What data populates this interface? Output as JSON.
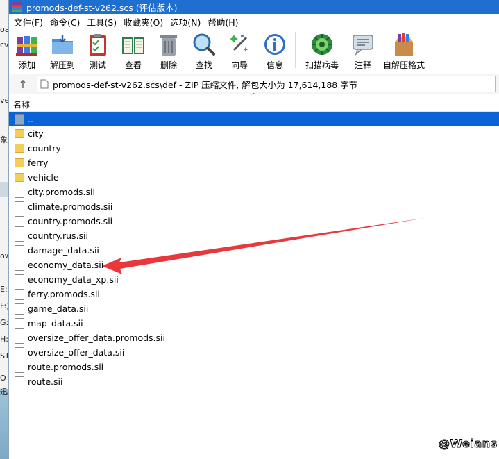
{
  "window": {
    "title": "promods-def-st-v262.scs (评估版本)"
  },
  "menu": [
    "文件(F)",
    "命令(C)",
    "工具(S)",
    "收藏夹(O)",
    "选项(N)",
    "帮助(H)"
  ],
  "toolbar": [
    {
      "id": "add",
      "label": "添加",
      "icon": "books-icon"
    },
    {
      "id": "extract",
      "label": "解压到",
      "icon": "folder-extract-icon"
    },
    {
      "id": "test",
      "label": "测试",
      "icon": "clipboard-check-icon"
    },
    {
      "id": "view",
      "label": "查看",
      "icon": "open-book-icon"
    },
    {
      "id": "delete",
      "label": "删除",
      "icon": "trash-icon"
    },
    {
      "id": "find",
      "label": "查找",
      "icon": "magnifier-icon"
    },
    {
      "id": "wizard",
      "label": "向导",
      "icon": "magic-wand-icon"
    },
    {
      "id": "info",
      "label": "信息",
      "icon": "info-icon"
    },
    {
      "id": "scan",
      "label": "扫描病毒",
      "icon": "virus-scan-icon"
    },
    {
      "id": "comment",
      "label": "注释",
      "icon": "comment-icon"
    },
    {
      "id": "sfx",
      "label": "自解压格式",
      "icon": "sfx-box-icon"
    }
  ],
  "address": {
    "path": "promods-def-st-v262.scs\\def - ZIP 压缩文件, 解包大小为 17,614,188 字节"
  },
  "list": {
    "column_name": "名称",
    "items": [
      {
        "name": "..",
        "type": "up",
        "selected": true
      },
      {
        "name": "city",
        "type": "folder"
      },
      {
        "name": "country",
        "type": "folder"
      },
      {
        "name": "ferry",
        "type": "folder"
      },
      {
        "name": "vehicle",
        "type": "folder"
      },
      {
        "name": "city.promods.sii",
        "type": "file"
      },
      {
        "name": "climate.promods.sii",
        "type": "file"
      },
      {
        "name": "country.promods.sii",
        "type": "file"
      },
      {
        "name": "country.rus.sii",
        "type": "file"
      },
      {
        "name": "damage_data.sii",
        "type": "file"
      },
      {
        "name": "economy_data.sii",
        "type": "file"
      },
      {
        "name": "economy_data_xp.sii",
        "type": "file"
      },
      {
        "name": "ferry.promods.sii",
        "type": "file"
      },
      {
        "name": "game_data.sii",
        "type": "file"
      },
      {
        "name": "map_data.sii",
        "type": "file"
      },
      {
        "name": "oversize_offer_data.promods.sii",
        "type": "file"
      },
      {
        "name": "oversize_offer_data.sii",
        "type": "file"
      },
      {
        "name": "route.promods.sii",
        "type": "file"
      },
      {
        "name": "route.sii",
        "type": "file"
      }
    ]
  },
  "background_fragments": [
    "oa",
    "cv",
    "ve",
    "象",
    "ow",
    "E:)",
    "F:)",
    "G:)",
    "H:)",
    "ST",
    "O",
    "迅"
  ],
  "colors": {
    "titlebar": "#1f6fd0",
    "selection": "#0a64d8",
    "annotation_arrow": "#e8383b"
  },
  "watermark": "@Weians"
}
